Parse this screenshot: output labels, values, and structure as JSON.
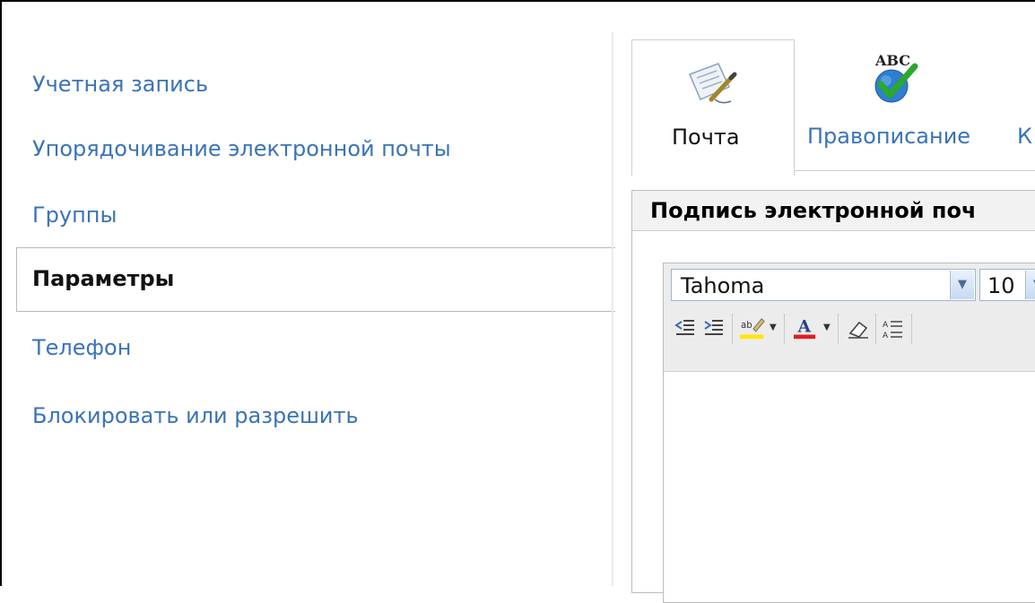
{
  "sidebar": {
    "items": [
      {
        "label": "Учетная запись"
      },
      {
        "label": "Упорядочивание электронной почты"
      },
      {
        "label": "Группы"
      },
      {
        "label": "Параметры",
        "selected": true
      },
      {
        "label": "Телефон"
      },
      {
        "label": "Блокировать или разрешить"
      }
    ]
  },
  "tabs": [
    {
      "label": "Почта",
      "icon": "mail-edit-icon",
      "active": true
    },
    {
      "label": "Правописание",
      "icon": "spellcheck-abc-icon",
      "icon_text": "ABC"
    },
    {
      "label": "К"
    }
  ],
  "signature_panel": {
    "title": "Подпись электронной поч",
    "font_family": {
      "value": "Tahoma"
    },
    "font_size": {
      "value": "10"
    },
    "toolbar_icons": [
      "indent-decrease-icon",
      "indent-increase-icon",
      "highlight-icon",
      "font-color-icon",
      "clear-format-icon",
      "line-spacing-icon"
    ]
  },
  "colors": {
    "link": "#3a73b8",
    "highlight": "#ffe600",
    "font_color_bar": "#e02020"
  }
}
